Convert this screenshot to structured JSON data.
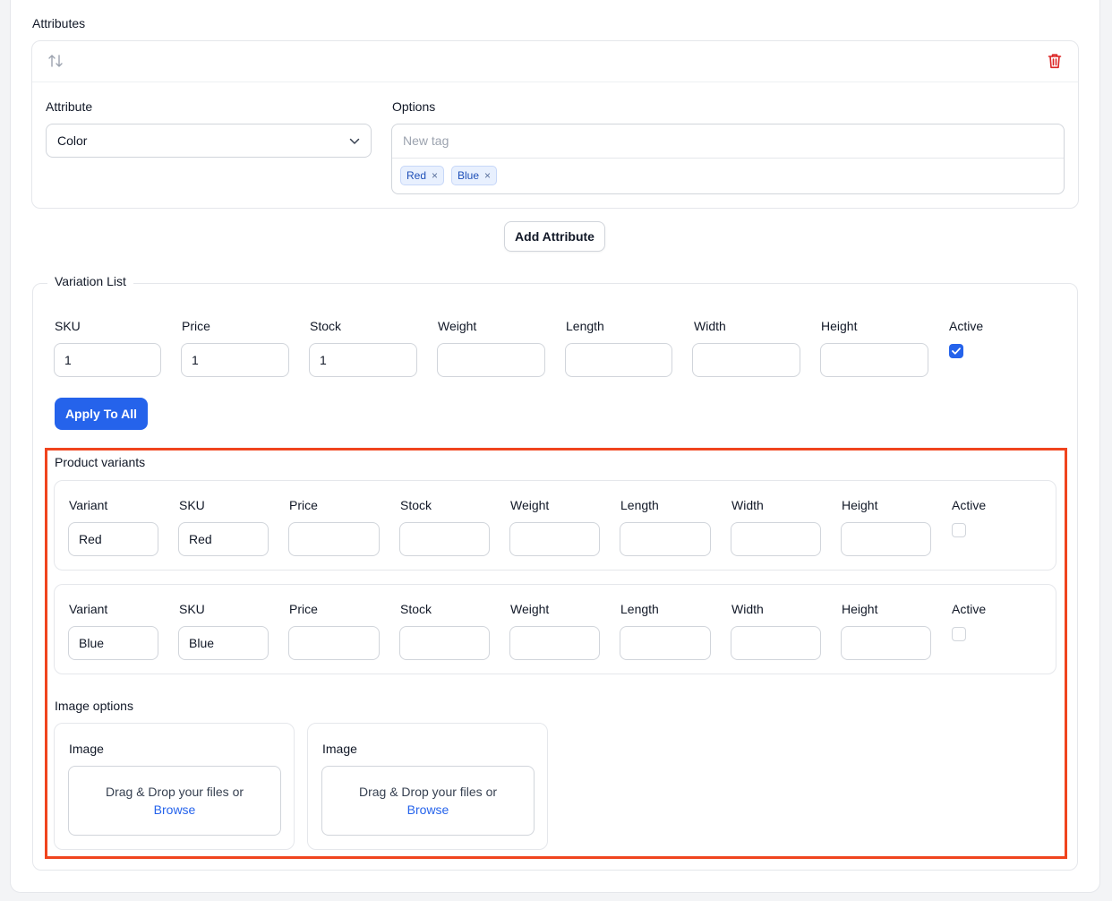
{
  "attributes": {
    "section_title": "Attributes",
    "attribute_label": "Attribute",
    "attribute_value": "Color",
    "options_label": "Options",
    "tag_placeholder": "New tag",
    "tags": [
      "Red",
      "Blue"
    ],
    "tag_remove": "×",
    "add_button": "Add Attribute"
  },
  "variation_list": {
    "legend": "Variation List",
    "columns": [
      "SKU",
      "Price",
      "Stock",
      "Weight",
      "Length",
      "Width",
      "Height",
      "Active"
    ],
    "values": [
      "1",
      "1",
      "1",
      "",
      "",
      "",
      ""
    ],
    "active": true,
    "apply_button": "Apply To All"
  },
  "product_variants": {
    "title": "Product variants",
    "columns": [
      "Variant",
      "SKU",
      "Price",
      "Stock",
      "Weight",
      "Length",
      "Width",
      "Height",
      "Active"
    ],
    "rows": [
      {
        "variant": "Red",
        "sku": "Red",
        "active": false
      },
      {
        "variant": "Blue",
        "sku": "Blue",
        "active": false
      }
    ]
  },
  "image_options": {
    "title": "Image options",
    "cards": [
      {
        "label": "Image",
        "drop_text": "Drag & Drop your files or",
        "browse": "Browse"
      },
      {
        "label": "Image",
        "drop_text": "Drag & Drop your files or",
        "browse": "Browse"
      }
    ]
  },
  "colors": {
    "primary": "#2563eb",
    "danger": "#dc2626",
    "highlight": "#f0441e"
  }
}
